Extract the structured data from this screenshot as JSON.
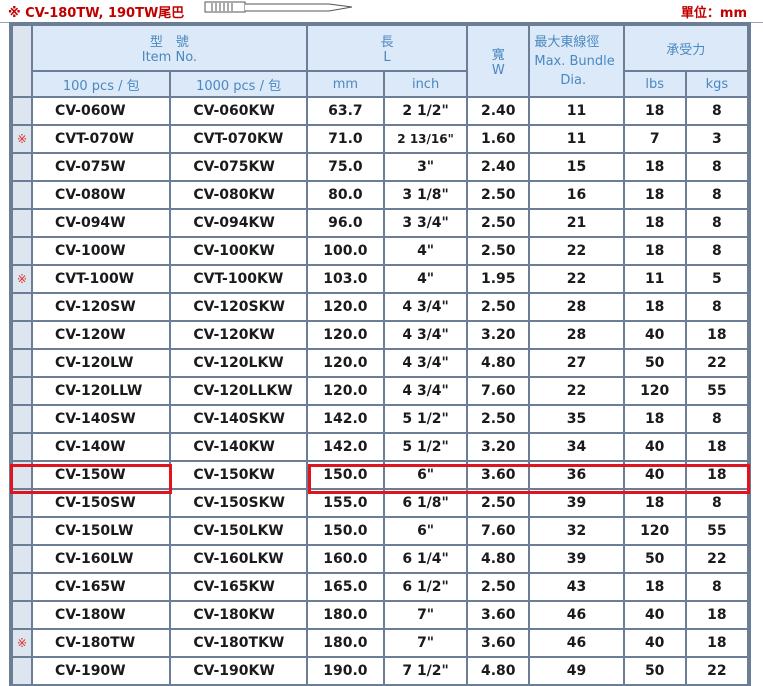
{
  "header": {
    "note": "※ CV-180TW, 190TW尾巴",
    "unit": "單位：mm"
  },
  "columns": {
    "item_no": "型　號",
    "item_no_en": "Item No.",
    "length": "長",
    "length_en": "L",
    "width": "寬",
    "width_en": "W",
    "bundle": "最大東線徑",
    "bundle_en": "Max. Bundle",
    "bundle_dia": "Dia.",
    "tensile": "承受力",
    "pack100": "100 pcs / 包",
    "pack1000": "1000 pcs / 包",
    "mm": "mm",
    "inch": "inch",
    "lbs": "lbs",
    "kgs": "kgs"
  },
  "rows": [
    {
      "mark": "",
      "a": "CV-060W",
      "b": "CV-060KW",
      "mm": "63.7",
      "inch": "2 1/2\"",
      "w": "2.40",
      "dia": "11",
      "lbs": "18",
      "kgs": "8"
    },
    {
      "mark": "※",
      "a": "CVT-070W",
      "b": "CVT-070KW",
      "mm": "71.0",
      "inch": "2 13/16\"",
      "w": "1.60",
      "dia": "11",
      "lbs": "7",
      "kgs": "3"
    },
    {
      "mark": "",
      "a": "CV-075W",
      "b": "CV-075KW",
      "mm": "75.0",
      "inch": "3\"",
      "w": "2.40",
      "dia": "15",
      "lbs": "18",
      "kgs": "8"
    },
    {
      "mark": "",
      "a": "CV-080W",
      "b": "CV-080KW",
      "mm": "80.0",
      "inch": "3 1/8\"",
      "w": "2.50",
      "dia": "16",
      "lbs": "18",
      "kgs": "8"
    },
    {
      "mark": "",
      "a": "CV-094W",
      "b": "CV-094KW",
      "mm": "96.0",
      "inch": "3 3/4\"",
      "w": "2.50",
      "dia": "21",
      "lbs": "18",
      "kgs": "8"
    },
    {
      "mark": "",
      "a": "CV-100W",
      "b": "CV-100KW",
      "mm": "100.0",
      "inch": "4\"",
      "w": "2.50",
      "dia": "22",
      "lbs": "18",
      "kgs": "8"
    },
    {
      "mark": "※",
      "a": "CVT-100W",
      "b": "CVT-100KW",
      "mm": "103.0",
      "inch": "4\"",
      "w": "1.95",
      "dia": "22",
      "lbs": "11",
      "kgs": "5"
    },
    {
      "mark": "",
      "a": "CV-120SW",
      "b": "CV-120SKW",
      "mm": "120.0",
      "inch": "4 3/4\"",
      "w": "2.50",
      "dia": "28",
      "lbs": "18",
      "kgs": "8"
    },
    {
      "mark": "",
      "a": "CV-120W",
      "b": "CV-120KW",
      "mm": "120.0",
      "inch": "4 3/4\"",
      "w": "3.20",
      "dia": "28",
      "lbs": "40",
      "kgs": "18"
    },
    {
      "mark": "",
      "a": "CV-120LW",
      "b": "CV-120LKW",
      "mm": "120.0",
      "inch": "4 3/4\"",
      "w": "4.80",
      "dia": "27",
      "lbs": "50",
      "kgs": "22"
    },
    {
      "mark": "",
      "a": "CV-120LLW",
      "b": "CV-120LLKW",
      "mm": "120.0",
      "inch": "4 3/4\"",
      "w": "7.60",
      "dia": "22",
      "lbs": "120",
      "kgs": "55"
    },
    {
      "mark": "",
      "a": "CV-140SW",
      "b": "CV-140SKW",
      "mm": "142.0",
      "inch": "5 1/2\"",
      "w": "2.50",
      "dia": "35",
      "lbs": "18",
      "kgs": "8"
    },
    {
      "mark": "",
      "a": "CV-140W",
      "b": "CV-140KW",
      "mm": "142.0",
      "inch": "5 1/2\"",
      "w": "3.20",
      "dia": "34",
      "lbs": "40",
      "kgs": "18"
    },
    {
      "mark": "",
      "a": "CV-150W",
      "b": "CV-150KW",
      "mm": "150.0",
      "inch": "6\"",
      "w": "3.60",
      "dia": "36",
      "lbs": "40",
      "kgs": "18"
    },
    {
      "mark": "",
      "a": "CV-150SW",
      "b": "CV-150SKW",
      "mm": "155.0",
      "inch": "6 1/8\"",
      "w": "2.50",
      "dia": "39",
      "lbs": "18",
      "kgs": "8"
    },
    {
      "mark": "",
      "a": "CV-150LW",
      "b": "CV-150LKW",
      "mm": "150.0",
      "inch": "6\"",
      "w": "7.60",
      "dia": "32",
      "lbs": "120",
      "kgs": "55"
    },
    {
      "mark": "",
      "a": "CV-160LW",
      "b": "CV-160LKW",
      "mm": "160.0",
      "inch": "6 1/4\"",
      "w": "4.80",
      "dia": "39",
      "lbs": "50",
      "kgs": "22"
    },
    {
      "mark": "",
      "a": "CV-165W",
      "b": "CV-165KW",
      "mm": "165.0",
      "inch": "6 1/2\"",
      "w": "2.50",
      "dia": "43",
      "lbs": "18",
      "kgs": "8"
    },
    {
      "mark": "",
      "a": "CV-180W",
      "b": "CV-180KW",
      "mm": "180.0",
      "inch": "7\"",
      "w": "3.60",
      "dia": "46",
      "lbs": "40",
      "kgs": "18"
    },
    {
      "mark": "※",
      "a": "CV-180TW",
      "b": "CV-180TKW",
      "mm": "180.0",
      "inch": "7\"",
      "w": "3.60",
      "dia": "46",
      "lbs": "40",
      "kgs": "18"
    },
    {
      "mark": "",
      "a": "CV-190W",
      "b": "CV-190KW",
      "mm": "190.0",
      "inch": "7 1/2\"",
      "w": "4.80",
      "dia": "49",
      "lbs": "50",
      "kgs": "22"
    }
  ]
}
